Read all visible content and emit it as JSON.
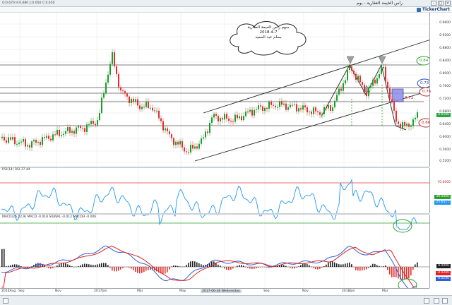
{
  "window": {
    "title": "راس الخيمة العقارية - يوم",
    "ohlc": "O:0.670  H:0.680  L:0.650  C:0.650",
    "brand": "TickerChart"
  },
  "annotation": {
    "line1": "سهم راس الخيمة العقارية",
    "line2": "2018-4-7",
    "line3": "بسام عبد الحميد"
  },
  "price_panel": {
    "y_ticks": [
      "0.9600",
      "0.9200",
      "0.8800",
      "0.8400",
      "0.8000",
      "0.7600",
      "0.7200",
      "0.6800",
      "0.6400",
      "0.6000",
      "0.5600",
      "0.5200"
    ],
    "last_price": "0.6500",
    "tag_color": "#26a641",
    "level_labels": [
      "0.84",
      "0.73",
      "0.76",
      "0.73",
      "0.66"
    ],
    "level_colors": [
      "#2a9d2a",
      "#2040c0",
      "#c02020",
      "#c02020",
      "#c02020"
    ]
  },
  "rsi_panel": {
    "label": "RSI(14)  RSI 37.44",
    "y_ticks": [
      "70.0000",
      "30.0000",
      "25.6517"
    ],
    "overbought": "70.0000",
    "oversold": "30.0000",
    "current": "25.6517"
  },
  "macd_panel": {
    "label": "MACD(26,12,9)  MACD -0.018  SIGNAL -0.012  MACDH -0.006",
    "y_ticks": [
      "0.0000",
      "-0.0200",
      "-0.0240"
    ],
    "zero": "0.0000"
  },
  "x_axis": {
    "labels": [
      "2016Aug",
      "Sep",
      "Nov",
      "2017Jan",
      "Mar",
      "May",
      "Jul",
      "Sep",
      "Nov",
      "2018Jan",
      "Mar"
    ],
    "highlight": "2017-06-28 Wednesday"
  },
  "colors": {
    "up_candle": "#1a9e2a",
    "down_candle": "#e03030",
    "rsi_line": "#2196f3",
    "macd_line": "#2b5fd9",
    "signal_line": "#e02020"
  }
}
